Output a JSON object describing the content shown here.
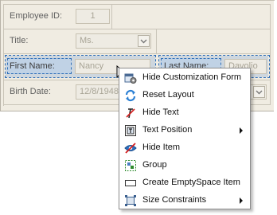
{
  "form": {
    "employee_id": {
      "label": "Employee ID:",
      "value": "1"
    },
    "title": {
      "label": "Title:",
      "value": "Ms."
    },
    "first_name": {
      "label": "First Name:",
      "value": "Nancy"
    },
    "last_name": {
      "label": "Last Name:",
      "value": "Davolio"
    },
    "birth_date": {
      "label": "Birth Date:",
      "value": "12/8/1948"
    }
  },
  "context_menu": {
    "items": [
      {
        "label": "Hide Customization Form",
        "icon": "customization-form-icon"
      },
      {
        "label": "Reset Layout",
        "icon": "reset-layout-icon"
      },
      {
        "label": "Hide Text",
        "icon": "hide-text-icon"
      },
      {
        "label": "Text Position",
        "icon": "text-position-icon",
        "submenu": true
      },
      {
        "label": "Hide Item",
        "icon": "hide-item-icon"
      },
      {
        "label": "Group",
        "icon": "group-icon"
      },
      {
        "label": "Create EmptySpace Item",
        "icon": "empty-space-icon"
      },
      {
        "label": "Size Constraints",
        "icon": "size-constraints-icon",
        "submenu": true
      }
    ]
  }
}
